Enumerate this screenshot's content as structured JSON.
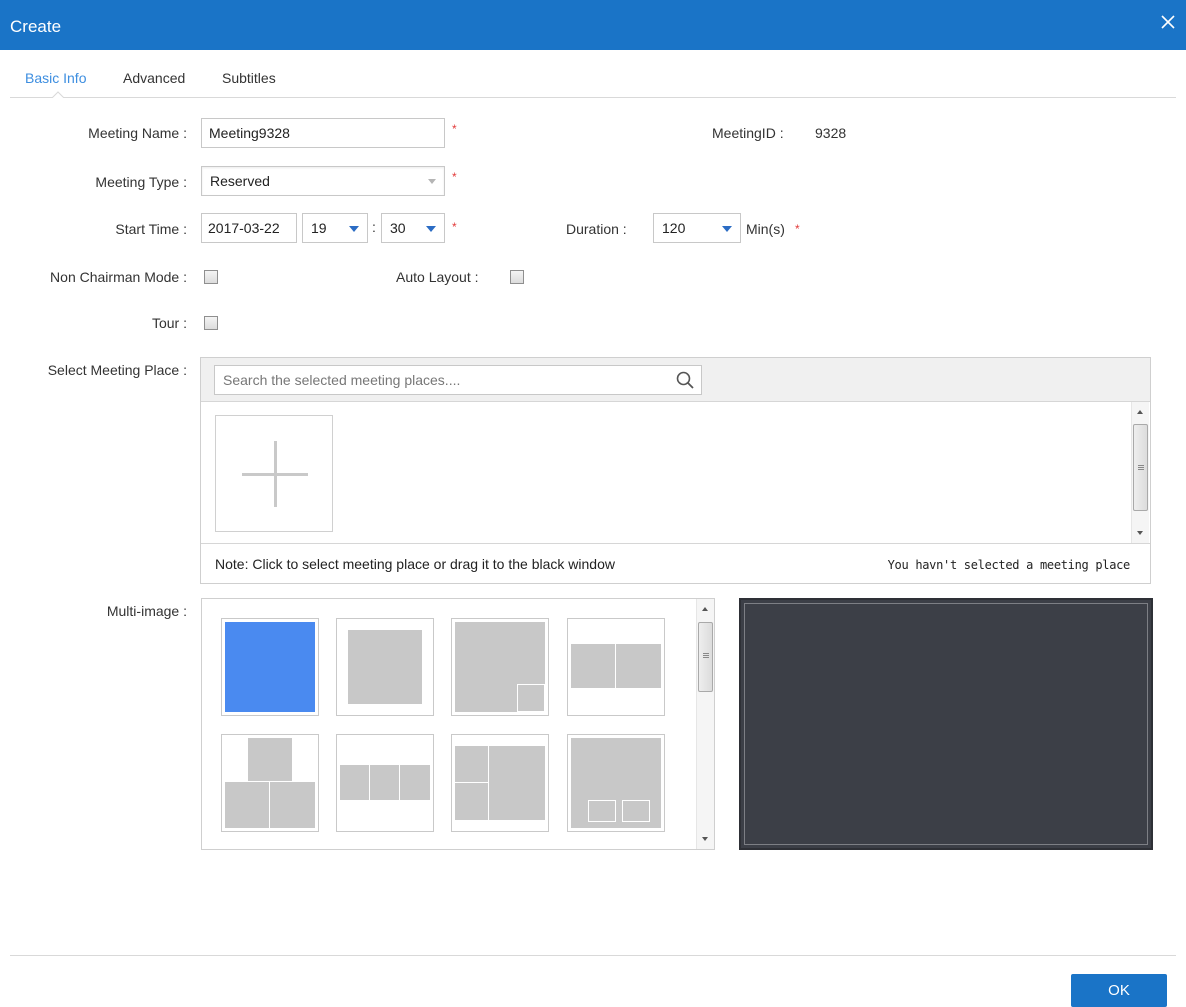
{
  "window": {
    "title": "Create"
  },
  "tabs": [
    {
      "label": "Basic Info",
      "active": true
    },
    {
      "label": "Advanced",
      "active": false
    },
    {
      "label": "Subtitles",
      "active": false
    }
  ],
  "form": {
    "meeting_name": {
      "label": "Meeting Name :",
      "value": "Meeting9328",
      "required_mark": "*"
    },
    "meeting_id": {
      "label": "MeetingID :",
      "value": "9328"
    },
    "meeting_type": {
      "label": "Meeting Type :",
      "value": "Reserved",
      "required_mark": "*"
    },
    "start_time": {
      "label": "Start Time :",
      "date": "2017-03-22",
      "hour": "19",
      "separator": ":",
      "minute": "30",
      "required_mark": "*"
    },
    "duration": {
      "label": "Duration :",
      "value": "120",
      "unit": "Min(s)",
      "required_mark": "*"
    },
    "non_chairman_mode": {
      "label": "Non Chairman Mode :",
      "checked": false
    },
    "auto_layout": {
      "label": "Auto Layout :",
      "checked": false
    },
    "tour": {
      "label": "Tour :",
      "checked": false
    }
  },
  "meeting_place": {
    "label": "Select Meeting Place :",
    "search_placeholder": "Search the selected meeting places....",
    "note": "Note: Click to select meeting place or drag it to the black window",
    "status": "You havn't selected a meeting place"
  },
  "multi_image": {
    "label": "Multi-image :",
    "selected_index": 0,
    "layouts": [
      "single-full",
      "single-center",
      "picture-in-picture",
      "two-side-by-side",
      "three-pyramid",
      "three-row",
      "three-left-stack",
      "one-plus-two-pip"
    ]
  },
  "footer": {
    "ok_label": "OK"
  },
  "colors": {
    "title_bar": "#1a74c7",
    "active_tab": "#3d8ee0",
    "required": "#e23b3b",
    "selected_layout": "#4a8af0",
    "preview_bg": "#3c3f47"
  }
}
